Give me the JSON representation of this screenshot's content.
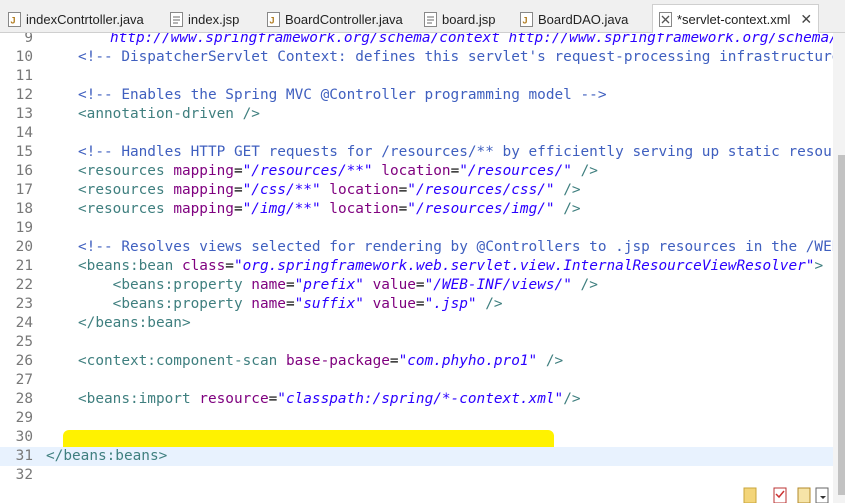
{
  "tabs": [
    {
      "label": "indexContrtoller.java",
      "icon": "java-file-icon"
    },
    {
      "label": "index.jsp",
      "icon": "jsp-file-icon"
    },
    {
      "label": "BoardController.java",
      "icon": "java-file-icon"
    },
    {
      "label": "board.jsp",
      "icon": "jsp-file-icon"
    },
    {
      "label": "BoardDAO.java",
      "icon": "java-file-icon"
    },
    {
      "label": "*servlet-context.xml",
      "icon": "xml-file-icon",
      "active": true
    }
  ],
  "close_symbol": "✕",
  "editor": {
    "lines": [
      {
        "n": "9"
      },
      {
        "n": "10",
        "comment": "<!-- DispatcherServlet Context: defines this servlet's request-processing infrastructure -->"
      },
      {
        "n": "11"
      },
      {
        "n": "12",
        "comment": "<!-- Enables the Spring MVC @Controller programming model -->"
      },
      {
        "n": "13",
        "tag": "<annotation-driven />"
      },
      {
        "n": "14"
      },
      {
        "n": "15",
        "comment": "<!-- Handles HTTP GET requests for /resources/** by efficiently serving up static resources in"
      },
      {
        "n": "16",
        "parts": [
          "<resources ",
          "mapping",
          "=",
          "\"/resources/**\"",
          " ",
          "location",
          "=",
          "\"/resources/\"",
          " />"
        ]
      },
      {
        "n": "17",
        "parts": [
          "<resources ",
          "mapping",
          "=",
          "\"/css/**\"",
          " ",
          "location",
          "=",
          "\"/resources/css/\"",
          " />"
        ]
      },
      {
        "n": "18",
        "parts": [
          "<resources ",
          "mapping",
          "=",
          "\"/img/**\"",
          " ",
          "location",
          "=",
          "\"/resources/img/\"",
          " />"
        ]
      },
      {
        "n": "19"
      },
      {
        "n": "20",
        "comment": "<!-- Resolves views selected for rendering by @Controllers to .jsp resources in the /WEB-INF/vi"
      },
      {
        "n": "21",
        "parts": [
          "<beans:bean ",
          "class",
          "=",
          "\"org.springframework.web.servlet.view.InternalResourceViewResolver\"",
          ">"
        ]
      },
      {
        "n": "22",
        "parts": [
          "    <beans:property ",
          "name",
          "=",
          "\"prefix\"",
          " ",
          "value",
          "=",
          "\"/WEB-INF/views/\"",
          " />"
        ]
      },
      {
        "n": "23",
        "parts": [
          "    <beans:property ",
          "name",
          "=",
          "\"suffix\"",
          " ",
          "value",
          "=",
          "\".jsp\"",
          " />"
        ]
      },
      {
        "n": "24",
        "tag": "</beans:bean>"
      },
      {
        "n": "25"
      },
      {
        "n": "26",
        "parts": [
          "<context:component-scan ",
          "base-package",
          "=",
          "\"com.phyho.pro1\"",
          " />"
        ]
      },
      {
        "n": "27"
      },
      {
        "n": "28",
        "parts": [
          "<beans:import ",
          "resource",
          "=",
          "\"classpath:/spring/*-context.xml\"",
          "/>"
        ]
      },
      {
        "n": "29"
      },
      {
        "n": "30"
      },
      {
        "n": "31",
        "rawtag": "</beans:beans>"
      },
      {
        "n": "32"
      }
    ],
    "top_partial": "http://www.springframework.org/schema/context http://www.springframework.org/schema/context",
    "current_line": "31",
    "highlighted_line": "28"
  },
  "colors": {
    "comment": "#3f5fbf",
    "tag": "#3f7f7f",
    "attr": "#7f007f",
    "value": "#2a00ff",
    "highlight": "#fff200"
  }
}
